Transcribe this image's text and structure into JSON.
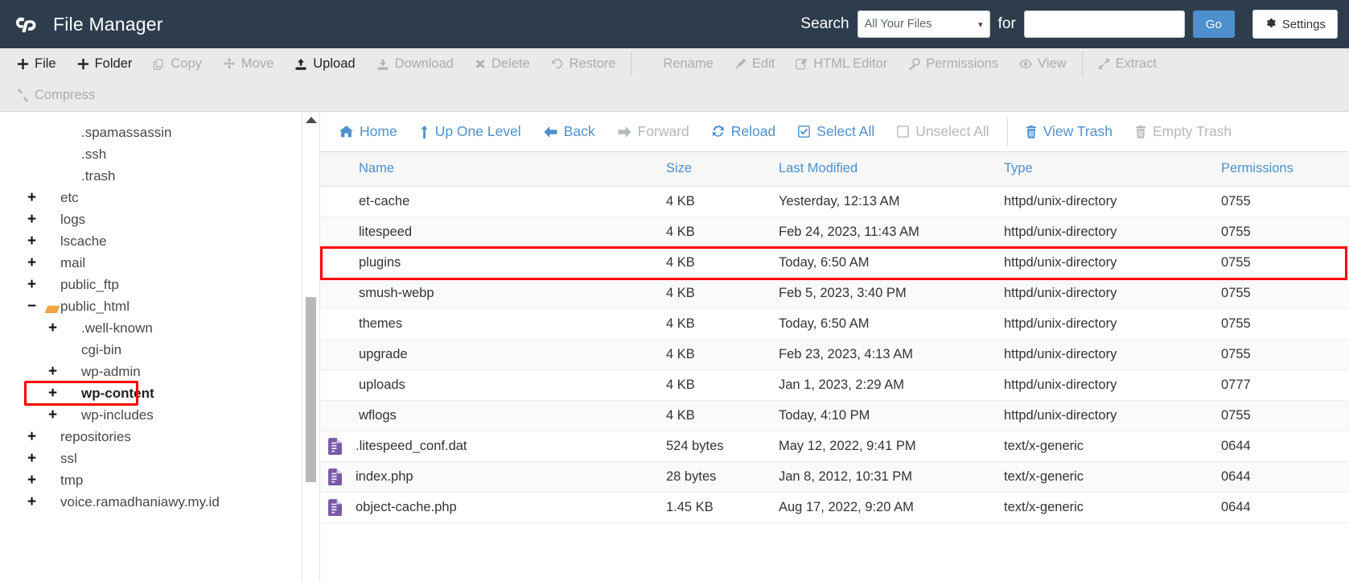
{
  "header": {
    "app_title": "File Manager",
    "logo_icon": "cpanel-logo-icon",
    "search_label": "Search",
    "search_scope_value": "All Your Files",
    "search_scope_caret": "chevron-down-icon",
    "for_label": "for",
    "search_value": "",
    "search_placeholder": "",
    "go_label": "Go",
    "settings_label": "Settings",
    "settings_icon": "gear-icon",
    "bg_color": "#2e3d4d",
    "accent_color": "#4d90cd"
  },
  "toolbar": {
    "items": [
      {
        "label": "File",
        "icon": "plus-icon",
        "enabled": true
      },
      {
        "label": "Folder",
        "icon": "plus-icon",
        "enabled": true
      },
      {
        "label": "Copy",
        "icon": "copy-icon",
        "enabled": false
      },
      {
        "label": "Move",
        "icon": "move-arrows-icon",
        "enabled": false
      },
      {
        "label": "Upload",
        "icon": "upload-icon",
        "enabled": true
      },
      {
        "label": "Download",
        "icon": "download-icon",
        "enabled": false
      },
      {
        "label": "Delete",
        "icon": "x-mark-icon",
        "enabled": false
      },
      {
        "label": "Restore",
        "icon": "restore-undo-icon",
        "enabled": false
      },
      {
        "label": "Rename",
        "icon": "file-icon",
        "enabled": false,
        "separator_before": true
      },
      {
        "label": "Edit",
        "icon": "pencil-icon",
        "enabled": false
      },
      {
        "label": "HTML Editor",
        "icon": "html-editor-icon",
        "enabled": false
      },
      {
        "label": "Permissions",
        "icon": "key-icon",
        "enabled": false
      },
      {
        "label": "View",
        "icon": "eye-icon",
        "enabled": false
      },
      {
        "label": "Extract",
        "icon": "extract-arrows-icon",
        "enabled": false,
        "separator_before": true
      }
    ],
    "row2": [
      {
        "label": "Compress",
        "icon": "compress-arrows-icon",
        "enabled": false
      }
    ]
  },
  "sidebar": {
    "scrollbar": {
      "up_arrow_icon": "scroll-up-arrow-icon"
    },
    "tree": [
      {
        "label": "",
        "indent": 1,
        "expander": "",
        "partial": true,
        "icon": "folder-icon"
      },
      {
        "label": ".spamassassin",
        "indent": 1,
        "expander": "",
        "icon": "folder-icon"
      },
      {
        "label": ".ssh",
        "indent": 1,
        "expander": "",
        "icon": "folder-icon"
      },
      {
        "label": ".trash",
        "indent": 1,
        "expander": "",
        "icon": "folder-icon"
      },
      {
        "label": "etc",
        "indent": 0,
        "expander": "+",
        "icon": "folder-icon"
      },
      {
        "label": "logs",
        "indent": 0,
        "expander": "+",
        "icon": "folder-icon"
      },
      {
        "label": "lscache",
        "indent": 0,
        "expander": "+",
        "icon": "folder-icon"
      },
      {
        "label": "mail",
        "indent": 0,
        "expander": "+",
        "icon": "folder-icon"
      },
      {
        "label": "public_ftp",
        "indent": 0,
        "expander": "+",
        "icon": "folder-icon"
      },
      {
        "label": "public_html",
        "indent": 0,
        "expander": "−",
        "icon": "folder-open-icon"
      },
      {
        "label": ".well-known",
        "indent": 1,
        "expander": "+",
        "icon": "folder-icon"
      },
      {
        "label": "cgi-bin",
        "indent": 1,
        "expander": "",
        "icon": "folder-icon"
      },
      {
        "label": "wp-admin",
        "indent": 1,
        "expander": "+",
        "icon": "folder-icon"
      },
      {
        "label": "wp-content",
        "indent": 1,
        "expander": "+",
        "icon": "folder-icon",
        "highlighted": true
      },
      {
        "label": "wp-includes",
        "indent": 1,
        "expander": "+",
        "icon": "folder-icon"
      },
      {
        "label": "repositories",
        "indent": 0,
        "expander": "+",
        "icon": "folder-icon"
      },
      {
        "label": "ssl",
        "indent": 0,
        "expander": "+",
        "icon": "folder-icon"
      },
      {
        "label": "tmp",
        "indent": 0,
        "expander": "+",
        "icon": "folder-icon"
      },
      {
        "label": "voice.ramadhaniawy.my.id",
        "indent": 0,
        "expander": "+",
        "icon": "folder-icon"
      }
    ]
  },
  "navbar": {
    "items": [
      {
        "label": "Home",
        "icon": "home-icon",
        "enabled": true
      },
      {
        "label": "Up One Level",
        "icon": "up-one-level-icon",
        "enabled": true
      },
      {
        "label": "Back",
        "icon": "arrow-left-icon",
        "enabled": true
      },
      {
        "label": "Forward",
        "icon": "arrow-right-icon",
        "enabled": false
      },
      {
        "label": "Reload",
        "icon": "reload-icon",
        "enabled": true
      },
      {
        "label": "Select All",
        "icon": "checkbox-checked-icon",
        "enabled": true
      },
      {
        "label": "Unselect All",
        "icon": "checkbox-empty-icon",
        "enabled": false
      },
      {
        "label": "View Trash",
        "icon": "trash-icon",
        "enabled": true,
        "separator_before": true
      },
      {
        "label": "Empty Trash",
        "icon": "trash-icon",
        "enabled": false
      }
    ]
  },
  "file_table": {
    "columns": [
      "Name",
      "Size",
      "Last Modified",
      "Type",
      "Permissions"
    ],
    "rows": [
      {
        "name": "et-cache",
        "size": "4 KB",
        "modified": "Yesterday, 12:13 AM",
        "type": "httpd/unix-directory",
        "permissions": "0755",
        "icon": "folder-icon"
      },
      {
        "name": "litespeed",
        "size": "4 KB",
        "modified": "Feb 24, 2023, 11:43 AM",
        "type": "httpd/unix-directory",
        "permissions": "0755",
        "icon": "folder-icon"
      },
      {
        "name": "plugins",
        "size": "4 KB",
        "modified": "Today, 6:50 AM",
        "type": "httpd/unix-directory",
        "permissions": "0755",
        "icon": "folder-icon",
        "highlighted": true
      },
      {
        "name": "smush-webp",
        "size": "4 KB",
        "modified": "Feb 5, 2023, 3:40 PM",
        "type": "httpd/unix-directory",
        "permissions": "0755",
        "icon": "folder-icon"
      },
      {
        "name": "themes",
        "size": "4 KB",
        "modified": "Today, 6:50 AM",
        "type": "httpd/unix-directory",
        "permissions": "0755",
        "icon": "folder-icon"
      },
      {
        "name": "upgrade",
        "size": "4 KB",
        "modified": "Feb 23, 2023, 4:13 AM",
        "type": "httpd/unix-directory",
        "permissions": "0755",
        "icon": "folder-icon"
      },
      {
        "name": "uploads",
        "size": "4 KB",
        "modified": "Jan 1, 2023, 2:29 AM",
        "type": "httpd/unix-directory",
        "permissions": "0777",
        "icon": "folder-icon"
      },
      {
        "name": "wflogs",
        "size": "4 KB",
        "modified": "Today, 4:10 PM",
        "type": "httpd/unix-directory",
        "permissions": "0755",
        "icon": "folder-icon"
      },
      {
        "name": ".litespeed_conf.dat",
        "size": "524 bytes",
        "modified": "May 12, 2022, 9:41 PM",
        "type": "text/x-generic",
        "permissions": "0644",
        "icon": "file-text-icon"
      },
      {
        "name": "index.php",
        "size": "28 bytes",
        "modified": "Jan 8, 2012, 10:31 PM",
        "type": "text/x-generic",
        "permissions": "0644",
        "icon": "file-text-icon"
      },
      {
        "name": "object-cache.php",
        "size": "1.45 KB",
        "modified": "Aug 17, 2022, 9:20 AM",
        "type": "text/x-generic",
        "permissions": "0644",
        "icon": "file-text-icon"
      }
    ]
  },
  "colors": {
    "folder": "#f0a442",
    "file": "#7a5ba8",
    "link": "#4d90cd",
    "highlight_box": "#ff0000",
    "header_bg": "#2e3d4d",
    "toolbar_bg": "#eaeaea"
  }
}
